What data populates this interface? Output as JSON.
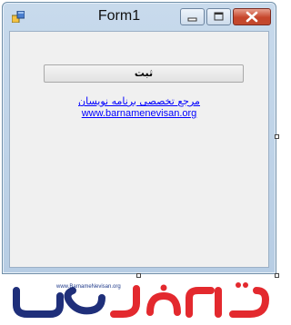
{
  "window": {
    "title": "Form1",
    "icons": {
      "app": "form-icon",
      "minimize": "minimize-icon",
      "maximize": "maximize-icon",
      "close": "close-icon"
    }
  },
  "form": {
    "submit_button_label": "ثبت",
    "link_primary": "مرجع تخصصی برنامه نویسان",
    "link_url": "www.barnamenevisan.org"
  },
  "watermark": {
    "url_text": "www.BarnameNevisan.org",
    "colors": {
      "red": "#e3292e",
      "navy": "#1f2f7a"
    }
  }
}
